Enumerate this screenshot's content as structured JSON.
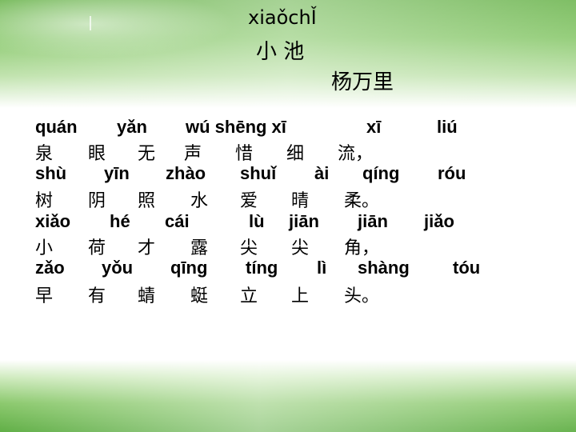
{
  "title": {
    "pinyin": "xiaǒchǏ",
    "hanzi": "小 池"
  },
  "author": "杨万里",
  "lines": [
    {
      "pinyin": [
        "quán",
        "yǎn",
        "wú shēng xī",
        "xī",
        "liú"
      ],
      "hanzi": [
        "泉",
        "眼",
        "无",
        "声",
        "惜",
        "细",
        "流，"
      ]
    },
    {
      "pinyin": [
        "shù",
        "yīn",
        "zhào",
        "shuǐ",
        "ài",
        "qíng",
        "róu"
      ],
      "hanzi": [
        "树",
        "阴",
        "照",
        "水",
        "爱",
        "晴",
        "柔。"
      ]
    },
    {
      "pinyin": [
        "xiǎo",
        "hé",
        "cái",
        "lù",
        "jiān",
        "jiān",
        "jiǎo"
      ],
      "hanzi": [
        "小",
        "荷",
        "才",
        "露",
        "尖",
        "尖",
        "角，"
      ]
    },
    {
      "pinyin": [
        "zǎo",
        "yǒu",
        "qīng",
        "tíng",
        "lì",
        "shàng",
        "tóu"
      ],
      "hanzi": [
        "早",
        "有",
        "蜻",
        "蜓",
        "立",
        "上",
        "头。"
      ]
    }
  ]
}
